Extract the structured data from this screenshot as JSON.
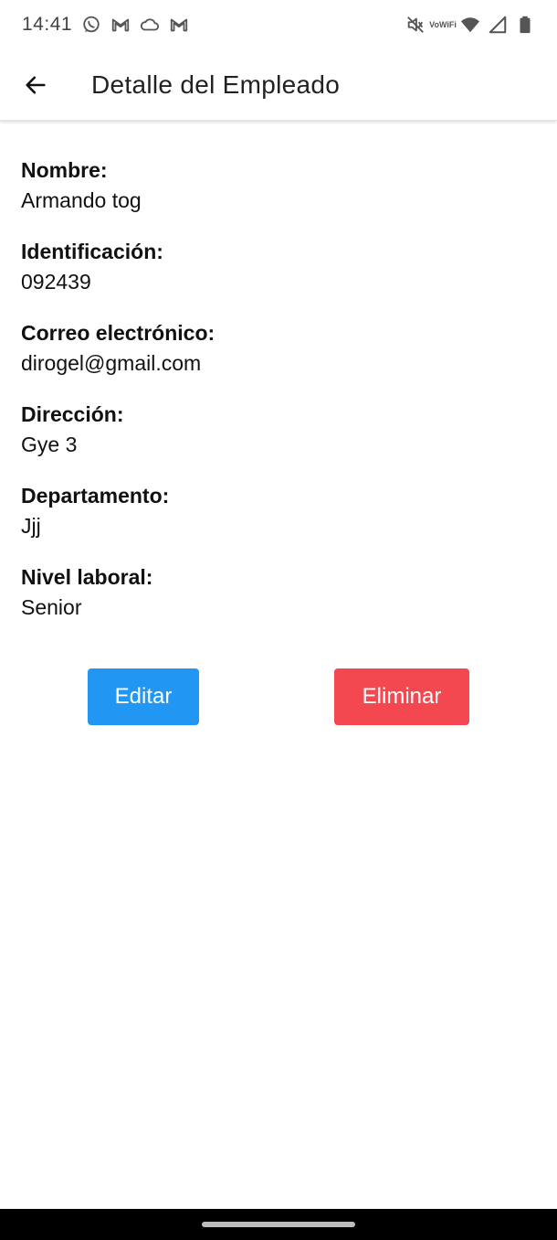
{
  "status_bar": {
    "time": "14:41",
    "left_icons": [
      "whatsapp-icon",
      "gmail-icon",
      "cloud-icon",
      "gmail-icon"
    ],
    "right_icons": [
      "mute-icon",
      "vowifi-icon",
      "wifi-icon",
      "signal-icon",
      "battery-icon"
    ],
    "vowifi_top": "Vo",
    "vowifi_bottom": "WiFi"
  },
  "app_bar": {
    "back_icon": "arrow-left-icon",
    "title": "Detalle del Empleado"
  },
  "employee": {
    "fields": [
      {
        "label": "Nombre:",
        "value": "Armando tog"
      },
      {
        "label": "Identificación:",
        "value": "092439"
      },
      {
        "label": "Correo electrónico:",
        "value": "dirogel@gmail.com"
      },
      {
        "label": "Dirección:",
        "value": "Gye 3"
      },
      {
        "label": "Departamento:",
        "value": "Jjj"
      },
      {
        "label": "Nivel laboral:",
        "value": "Senior"
      }
    ]
  },
  "actions": {
    "edit_label": "Editar",
    "delete_label": "Eliminar",
    "edit_color": "#2196f3",
    "delete_color": "#f44850"
  }
}
